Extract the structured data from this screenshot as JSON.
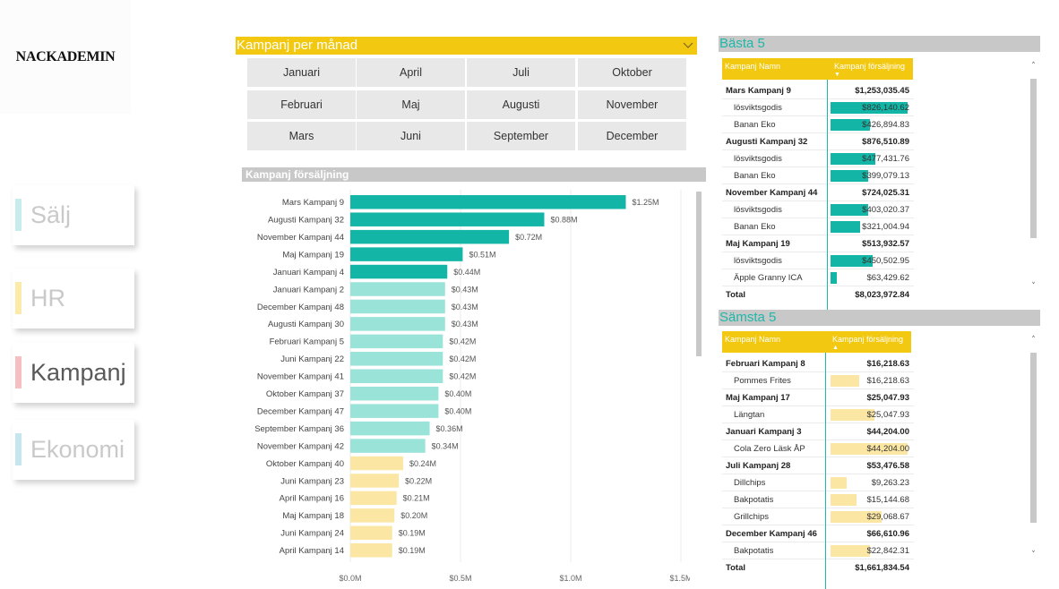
{
  "logo": {
    "text": "NACKADEMIN"
  },
  "nav": [
    {
      "label": "Sälj",
      "color": "#c9c9c9",
      "accent": "#c6ecec",
      "top": 207
    },
    {
      "label": "HR",
      "color": "#c9c9c9",
      "accent": "#fbeaa8",
      "top": 300
    },
    {
      "label": "Kampanj",
      "color": "#595959",
      "accent": "#f7c0c0",
      "top": 383
    },
    {
      "label": "Ekonomi",
      "color": "#c9c9c9",
      "accent": "#c5e6ef",
      "top": 469
    }
  ],
  "slicer": {
    "title": "Kampanj per månad",
    "months": [
      [
        "Januari",
        "April",
        "Juli",
        "Oktober"
      ],
      [
        "Februari",
        "Maj",
        "Augusti",
        "November"
      ],
      [
        "Mars",
        "Juni",
        "September",
        "December"
      ]
    ]
  },
  "colors": {
    "accent_yellow": "#f2c811",
    "teal": "#13b6a6",
    "teal_light": "#99e3d8",
    "yellow_light": "#fbe7a3",
    "teal_text": "#1db8a8"
  },
  "chart_data": {
    "type": "bar",
    "orientation": "horizontal",
    "title": "Kampanj försäljning",
    "categories": [
      "Mars Kampanj 9",
      "Augusti Kampanj 32",
      "November Kampanj 44",
      "Maj Kampanj 19",
      "Januari Kampanj 4",
      "Januari Kampanj 2",
      "December Kampanj 48",
      "Augusti Kampanj 30",
      "Februari Kampanj 5",
      "Juni Kampanj 22",
      "November Kampanj 41",
      "Oktober Kampanj 37",
      "December Kampanj 47",
      "September Kampanj 36",
      "November Kampanj 42",
      "Oktober Kampanj 40",
      "Juni Kampanj 23",
      "April Kampanj 16",
      "Maj Kampanj 18",
      "Juni Kampanj 24",
      "April Kampanj 14"
    ],
    "values": [
      1.25,
      0.88,
      0.72,
      0.51,
      0.44,
      0.43,
      0.43,
      0.43,
      0.42,
      0.42,
      0.42,
      0.4,
      0.4,
      0.36,
      0.34,
      0.24,
      0.22,
      0.21,
      0.2,
      0.19,
      0.19
    ],
    "value_labels": [
      "$1.25M",
      "$0.88M",
      "$0.72M",
      "$0.51M",
      "$0.44M",
      "$0.43M",
      "$0.43M",
      "$0.43M",
      "$0.42M",
      "$0.42M",
      "$0.42M",
      "$0.40M",
      "$0.40M",
      "$0.36M",
      "$0.34M",
      "$0.24M",
      "$0.22M",
      "$0.21M",
      "$0.20M",
      "$0.19M",
      "$0.19M"
    ],
    "bar_colors": [
      "#13b6a6",
      "#13b6a6",
      "#13b6a6",
      "#13b6a6",
      "#13b6a6",
      "#99e3d8",
      "#99e3d8",
      "#99e3d8",
      "#99e3d8",
      "#99e3d8",
      "#99e3d8",
      "#99e3d8",
      "#99e3d8",
      "#99e3d8",
      "#99e3d8",
      "#fbe7a3",
      "#fbe7a3",
      "#fbe7a3",
      "#fbe7a3",
      "#fbe7a3",
      "#fbe7a3"
    ],
    "xlim": [
      0,
      1.5
    ],
    "xticks": [
      0,
      0.5,
      1.0,
      1.5
    ],
    "xtick_labels": [
      "$0.0M",
      "$0.5M",
      "$1.0M",
      "$1.5M"
    ],
    "grid": true,
    "xlabel": "",
    "ylabel": ""
  },
  "best": {
    "title": "Bästa 5",
    "col_name": "Kampanj Namn",
    "col_value": "Kampanj försäljning",
    "sort_arrow": "▼",
    "bar_color": "#13b6a6",
    "rows": [
      {
        "type": "parent",
        "name": "Mars Kampanj 9",
        "value": "$1,253,035.45"
      },
      {
        "type": "child",
        "name": "lösviktsgodis",
        "value": "$826,140.62",
        "frac": 1.0
      },
      {
        "type": "child",
        "name": "Banan Eko",
        "value": "$426,894.83",
        "frac": 0.517
      },
      {
        "type": "parent",
        "name": "Augusti Kampanj 32",
        "value": "$876,510.89"
      },
      {
        "type": "child",
        "name": "lösviktsgodis",
        "value": "$477,431.76",
        "frac": 0.578
      },
      {
        "type": "child",
        "name": "Banan Eko",
        "value": "$399,079.13",
        "frac": 0.483
      },
      {
        "type": "parent",
        "name": "November Kampanj 44",
        "value": "$724,025.31"
      },
      {
        "type": "child",
        "name": "lösviktsgodis",
        "value": "$403,020.37",
        "frac": 0.488
      },
      {
        "type": "child",
        "name": "Banan Eko",
        "value": "$321,004.94",
        "frac": 0.389
      },
      {
        "type": "parent",
        "name": "Maj Kampanj 19",
        "value": "$513,932.57"
      },
      {
        "type": "child",
        "name": "lösviktsgodis",
        "value": "$450,502.95",
        "frac": 0.545
      },
      {
        "type": "child",
        "name": "Äpple Granny ICA",
        "value": "$63,429.62",
        "frac": 0.077
      },
      {
        "type": "total",
        "name": "Total",
        "value": "$8,023,972.84"
      }
    ]
  },
  "worst": {
    "title": "Sämsta 5",
    "col_name": "Kampanj Namn",
    "col_value": "Kampanj försäljning",
    "sort_arrow": "▲",
    "bar_color": "#fbe7a3",
    "rows": [
      {
        "type": "parent",
        "name": "Februari Kampanj 8",
        "value": "$16,218.63"
      },
      {
        "type": "child",
        "name": "Pommes Frites",
        "value": "$16,218.63",
        "frac": 0.367
      },
      {
        "type": "parent",
        "name": "Maj Kampanj 17",
        "value": "$25,047.93"
      },
      {
        "type": "child",
        "name": "Längtan",
        "value": "$25,047.93",
        "frac": 0.567
      },
      {
        "type": "parent",
        "name": "Januari Kampanj 3",
        "value": "$44,204.00"
      },
      {
        "type": "child",
        "name": "Cola Zero Läsk ÅP",
        "value": "$44,204.00",
        "frac": 1.0
      },
      {
        "type": "parent",
        "name": "Juli Kampanj 28",
        "value": "$53,476.58"
      },
      {
        "type": "child",
        "name": "Dillchips",
        "value": "$9,263.23",
        "frac": 0.21
      },
      {
        "type": "child",
        "name": "Bakpotatis",
        "value": "$15,144.68",
        "frac": 0.343
      },
      {
        "type": "child",
        "name": "Grillchips",
        "value": "$29,068.67",
        "frac": 0.658
      },
      {
        "type": "parent",
        "name": "December Kampanj 46",
        "value": "$66,610.96"
      },
      {
        "type": "child",
        "name": "Bakpotatis",
        "value": "$22,842.31",
        "frac": 0.517
      },
      {
        "type": "total",
        "name": "Total",
        "value": "$1,661,834.54"
      }
    ]
  },
  "scroll": {
    "up": "˄",
    "down": "˅"
  }
}
